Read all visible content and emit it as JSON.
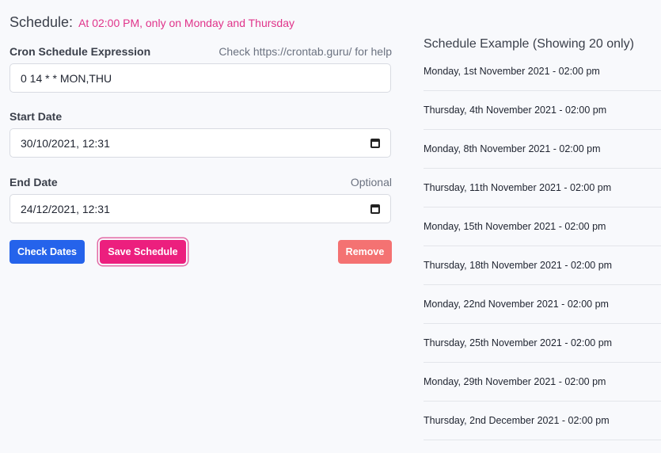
{
  "header": {
    "label": "Schedule:",
    "description": "At 02:00 PM, only on Monday and Thursday"
  },
  "form": {
    "cron": {
      "label": "Cron Schedule Expression",
      "hint": "Check https://crontab.guru/ for help",
      "value": "0 14 * * MON,THU"
    },
    "start": {
      "label": "Start Date",
      "value": "30/10/2021, 12:31"
    },
    "end": {
      "label": "End Date",
      "hint": "Optional",
      "value": "24/12/2021, 12:31"
    }
  },
  "buttons": {
    "check": "Check Dates",
    "save": "Save Schedule",
    "remove": "Remove"
  },
  "example": {
    "title": "Schedule Example (Showing 20 only)",
    "items": [
      "Monday, 1st November 2021 - 02:00 pm",
      "Thursday, 4th November 2021 - 02:00 pm",
      "Monday, 8th November 2021 - 02:00 pm",
      "Thursday, 11th November 2021 - 02:00 pm",
      "Monday, 15th November 2021 - 02:00 pm",
      "Thursday, 18th November 2021 - 02:00 pm",
      "Monday, 22nd November 2021 - 02:00 pm",
      "Thursday, 25th November 2021 - 02:00 pm",
      "Monday, 29th November 2021 - 02:00 pm",
      "Thursday, 2nd December 2021 - 02:00 pm"
    ]
  },
  "colors": {
    "accent": "#e0338a",
    "primary": "#2563eb",
    "save": "#ec1f7e",
    "remove": "#f47272"
  }
}
